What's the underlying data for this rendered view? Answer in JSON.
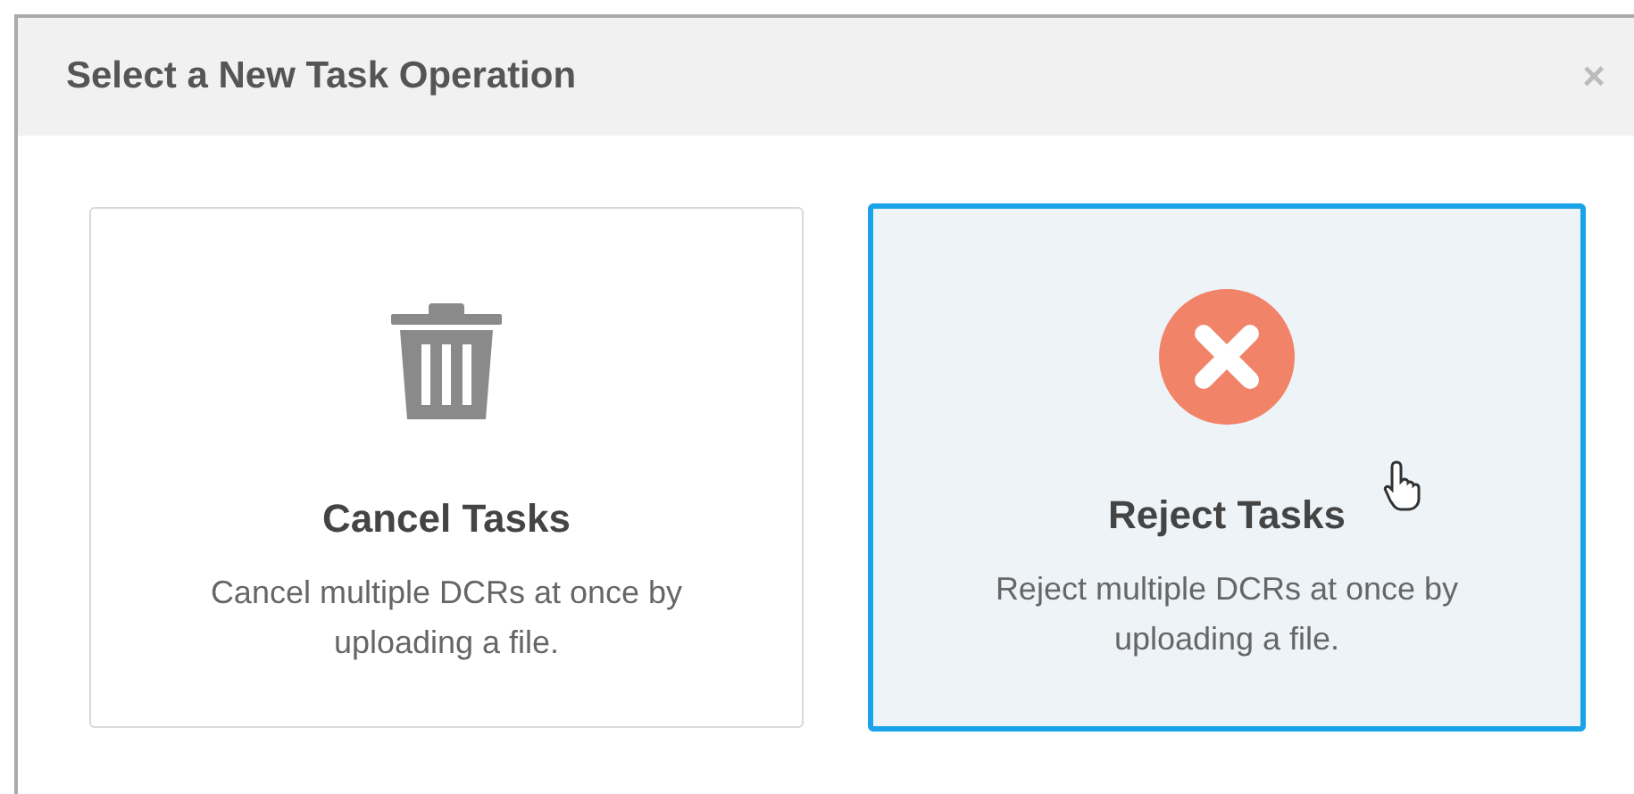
{
  "dialog": {
    "title": "Select a New Task Operation",
    "close": "×"
  },
  "options": [
    {
      "kind": "trash",
      "title": "Cancel Tasks",
      "description": "Cancel multiple DCRs at once by uploading a file.",
      "selected": false
    },
    {
      "kind": "reject",
      "title": "Reject Tasks",
      "description": "Reject multiple DCRs at once by uploading a file.",
      "selected": true
    }
  ]
}
